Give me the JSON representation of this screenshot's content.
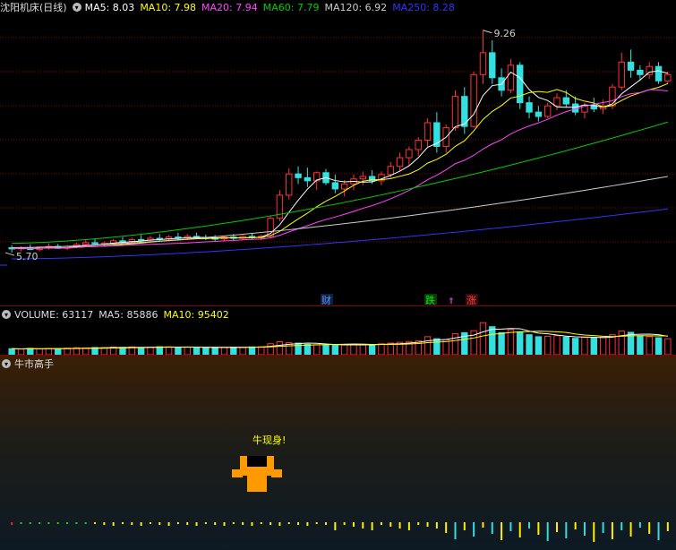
{
  "main": {
    "title": "沈阳机床(日线)",
    "ma_labels": [
      {
        "text": "MA5: 8.03",
        "color": "#ffffff"
      },
      {
        "text": "MA10: 7.98",
        "color": "#ffff00"
      },
      {
        "text": "MA20: 7.94",
        "color": "#ff44ff"
      },
      {
        "text": "MA60: 7.79",
        "color": "#00cc00"
      },
      {
        "text": "MA120: 6.92",
        "color": "#cccccc"
      },
      {
        "text": "MA250: 8.28",
        "color": "#3333ff"
      }
    ],
    "high_label": "9.26",
    "low_label": "5.70",
    "events": [
      {
        "text": "财",
        "color": "#5599ff",
        "bg": "#102040"
      },
      {
        "text": "跌",
        "color": "#00ee00",
        "bg": "#0a3a0a"
      },
      {
        "text": "涨",
        "color": "#ff4444",
        "bg": "#3a0a0a"
      }
    ]
  },
  "volume": {
    "labels": [
      {
        "text": "VOLUME: 63117",
        "color": "#dddddd"
      },
      {
        "text": "MA5: 85886",
        "color": "#dddddd"
      },
      {
        "text": "MA10: 95402",
        "color": "#ffff00"
      }
    ]
  },
  "indicator": {
    "title": "牛市高手",
    "signal_text": "牛现身!",
    "signal_color": "#ffff00",
    "bull_color": "#ff9900"
  },
  "colors": {
    "up": "#ff3333",
    "down": "#33e0e0",
    "grid": "#8b0000"
  },
  "chart_data": {
    "type": "candlestick",
    "title": "沈阳机床(日线)",
    "price_range": [
      5.7,
      9.26
    ],
    "ohlc": [
      [
        5.78,
        5.82,
        5.7,
        5.76
      ],
      [
        5.76,
        5.8,
        5.72,
        5.78
      ],
      [
        5.78,
        5.83,
        5.74,
        5.75
      ],
      [
        5.75,
        5.8,
        5.72,
        5.79
      ],
      [
        5.79,
        5.85,
        5.75,
        5.8
      ],
      [
        5.8,
        5.84,
        5.76,
        5.77
      ],
      [
        5.77,
        5.82,
        5.74,
        5.8
      ],
      [
        5.8,
        5.86,
        5.77,
        5.83
      ],
      [
        5.83,
        5.9,
        5.8,
        5.86
      ],
      [
        5.86,
        5.92,
        5.82,
        5.84
      ],
      [
        5.84,
        5.88,
        5.8,
        5.85
      ],
      [
        5.85,
        5.92,
        5.82,
        5.89
      ],
      [
        5.89,
        5.95,
        5.85,
        5.88
      ],
      [
        5.88,
        5.94,
        5.84,
        5.91
      ],
      [
        5.91,
        5.98,
        5.87,
        5.9
      ],
      [
        5.9,
        5.97,
        5.86,
        5.93
      ],
      [
        5.93,
        6.0,
        5.89,
        5.92
      ],
      [
        5.92,
        5.98,
        5.88,
        5.95
      ],
      [
        5.95,
        6.02,
        5.9,
        5.94
      ],
      [
        5.94,
        6.0,
        5.9,
        5.96
      ],
      [
        5.96,
        6.02,
        5.92,
        5.94
      ],
      [
        5.94,
        5.99,
        5.9,
        5.93
      ],
      [
        5.93,
        5.98,
        5.88,
        5.92
      ],
      [
        5.92,
        5.97,
        5.88,
        5.95
      ],
      [
        5.95,
        6.0,
        5.9,
        5.93
      ],
      [
        5.93,
        5.98,
        5.9,
        5.96
      ],
      [
        5.96,
        6.01,
        5.92,
        5.94
      ],
      [
        5.94,
        5.99,
        5.9,
        5.96
      ],
      [
        5.96,
        6.3,
        5.94,
        6.25
      ],
      [
        6.25,
        6.7,
        6.2,
        6.62
      ],
      [
        6.62,
        7.05,
        6.55,
        6.96
      ],
      [
        6.96,
        7.08,
        6.8,
        6.9
      ],
      [
        6.9,
        7.06,
        6.75,
        6.85
      ],
      [
        6.85,
        7.0,
        6.7,
        6.98
      ],
      [
        6.98,
        7.04,
        6.78,
        6.82
      ],
      [
        6.82,
        6.95,
        6.65,
        6.72
      ],
      [
        6.72,
        6.86,
        6.6,
        6.8
      ],
      [
        6.8,
        6.95,
        6.7,
        6.88
      ],
      [
        6.88,
        7.0,
        6.78,
        6.92
      ],
      [
        6.92,
        7.02,
        6.8,
        6.85
      ],
      [
        6.85,
        7.0,
        6.78,
        6.95
      ],
      [
        6.95,
        7.15,
        6.9,
        7.08
      ],
      [
        7.08,
        7.3,
        7.0,
        7.22
      ],
      [
        7.22,
        7.4,
        7.1,
        7.35
      ],
      [
        7.35,
        7.55,
        7.25,
        7.5
      ],
      [
        7.5,
        7.85,
        7.4,
        7.78
      ],
      [
        7.78,
        7.95,
        7.3,
        7.4
      ],
      [
        7.4,
        7.75,
        7.3,
        7.7
      ],
      [
        7.7,
        8.3,
        7.65,
        8.2
      ],
      [
        8.2,
        8.35,
        7.6,
        7.72
      ],
      [
        7.72,
        8.6,
        7.7,
        8.55
      ],
      [
        8.55,
        9.26,
        8.4,
        8.9
      ],
      [
        8.9,
        9.1,
        8.4,
        8.5
      ],
      [
        8.5,
        8.65,
        8.2,
        8.3
      ],
      [
        8.3,
        8.8,
        8.25,
        8.7
      ],
      [
        8.7,
        8.75,
        8.0,
        8.1
      ],
      [
        8.1,
        8.2,
        7.85,
        7.95
      ],
      [
        7.95,
        8.05,
        7.8,
        7.88
      ],
      [
        7.88,
        8.1,
        7.85,
        8.05
      ],
      [
        8.05,
        8.25,
        7.98,
        8.18
      ],
      [
        8.18,
        8.3,
        8.02,
        8.08
      ],
      [
        8.08,
        8.2,
        7.9,
        7.95
      ],
      [
        7.95,
        8.1,
        7.85,
        8.06
      ],
      [
        8.06,
        8.18,
        7.95,
        8.0
      ],
      [
        8.0,
        8.15,
        7.92,
        8.05
      ],
      [
        8.05,
        8.4,
        8.0,
        8.35
      ],
      [
        8.35,
        8.9,
        8.3,
        8.75
      ],
      [
        8.75,
        8.95,
        8.5,
        8.62
      ],
      [
        8.62,
        8.7,
        8.45,
        8.55
      ],
      [
        8.55,
        8.75,
        8.48,
        8.68
      ],
      [
        8.68,
        8.75,
        8.4,
        8.45
      ],
      [
        8.45,
        8.6,
        8.4,
        8.55
      ]
    ],
    "volume": [
      30,
      28,
      32,
      29,
      31,
      30,
      33,
      35,
      34,
      36,
      35,
      38,
      37,
      39,
      36,
      38,
      40,
      39,
      37,
      38,
      36,
      35,
      37,
      36,
      38,
      37,
      39,
      40,
      55,
      65,
      60,
      58,
      52,
      50,
      48,
      47,
      50,
      52,
      49,
      51,
      55,
      58,
      62,
      66,
      70,
      90,
      80,
      75,
      105,
      110,
      120,
      160,
      140,
      110,
      125,
      115,
      100,
      90,
      92,
      95,
      88,
      82,
      86,
      84,
      88,
      100,
      118,
      112,
      95,
      90,
      85,
      80
    ]
  }
}
